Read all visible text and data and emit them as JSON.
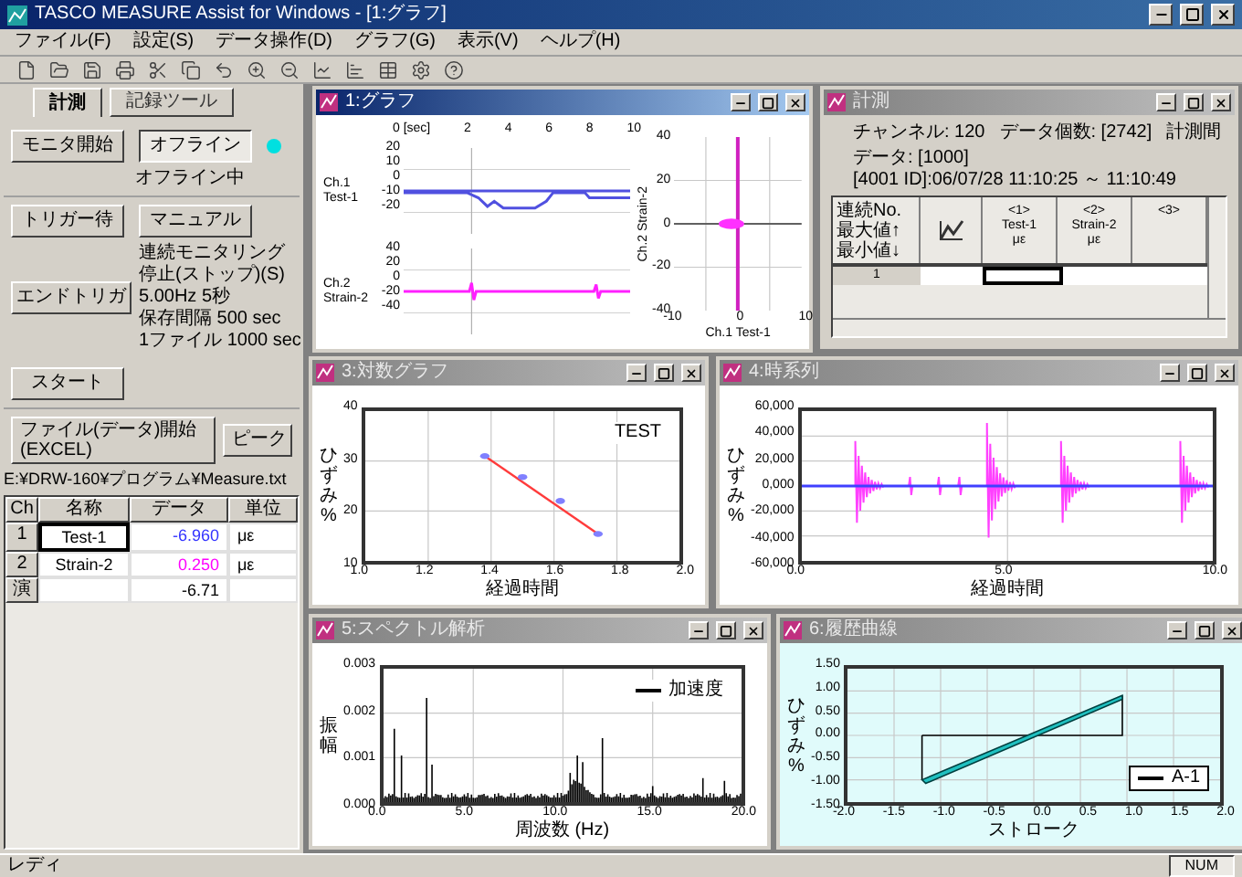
{
  "window": {
    "title": "TASCO MEASURE Assist for Windows - [1:グラフ]"
  },
  "menu": [
    "ファイル(F)",
    "設定(S)",
    "データ操作(D)",
    "グラフ(G)",
    "表示(V)",
    "ヘルプ(H)"
  ],
  "left_panel": {
    "tabs": [
      {
        "label": "計測",
        "selected": true
      },
      {
        "label": "記録ツール",
        "selected": false
      }
    ],
    "mode_buttons": [
      {
        "label": "モニタ開始",
        "pressed": false
      },
      {
        "label": "オフライン",
        "pressed": true
      }
    ],
    "lamp": {
      "on": true
    },
    "mode_status": "オフライン中",
    "trigger_buttons": [
      "トリガー待",
      "マニュアル"
    ],
    "end_button": "エンドトリガ",
    "settings_lines": [
      "連続モニタリング",
      "停止(ストップ)(S)",
      "5.00Hz 5秒",
      "保存間隔 500 sec",
      "1ファイル 1000 sec"
    ],
    "start_button": "スタート",
    "file_button": "ファイル(データ)開始(EXCEL)",
    "peak_button": "ピーク",
    "path": "E:¥DRW-160¥プログラム¥Measure.txt",
    "table": {
      "columns": [
        "Ch",
        "名称",
        "データ",
        "単位"
      ],
      "rows": [
        {
          "ch": "1",
          "name": "Test-1",
          "value": "-6.960",
          "unit": "με",
          "color": "#3333ff",
          "selected": true
        },
        {
          "ch": "2",
          "name": "Strain-2",
          "value": "0.250",
          "unit": "με",
          "color": "#ff00ff",
          "selected": false
        },
        {
          "ch": "演",
          "value": "-6.71",
          "color": "#000000",
          "selected": false
        }
      ]
    }
  },
  "windows": [
    {
      "kind": "time",
      "title": "1:グラフ",
      "active": true,
      "xticks": [
        "0 [sec]",
        "2",
        "4",
        "6",
        "8",
        "10"
      ],
      "channels": [
        {
          "label": "Ch.1",
          "name": "Test-1",
          "yticks": [
            "20",
            "10",
            "0",
            "-10",
            "-20"
          ]
        },
        {
          "label": "Ch.2",
          "name": "Strain-2",
          "yticks": [
            "40",
            "20",
            "0",
            "-20",
            "-40"
          ]
        }
      ],
      "xy": {
        "yticks": [
          "40",
          "20",
          "0",
          "-20",
          "-40"
        ],
        "xticks": [
          "-10",
          "0",
          "10"
        ],
        "xlabel": "Ch.1 Test-1",
        "ylabel": "Ch.2 Strain-2"
      }
    },
    {
      "kind": "table",
      "title": "計測",
      "active": false,
      "lines": [
        [
          "チャンネル: 120",
          "データ個数: [2742]",
          "計測間"
        ],
        [
          "データ: [1000]",
          "[4001 ID]:06/07/28 11:10:25 ～ 11:10:49"
        ]
      ],
      "header": [
        "連続No.",
        "最大値↑",
        "最小値↓"
      ],
      "columns": [
        [
          "<1>",
          "Test-1",
          "με"
        ],
        [
          "<2>",
          "Strain-2",
          "με"
        ],
        [
          "<3>"
        ]
      ],
      "row_label": "1"
    },
    {
      "kind": "log-line",
      "title": "3:対数グラフ",
      "active": false,
      "yticks": [
        "40",
        "30",
        "20",
        "10"
      ],
      "xticks": [
        "1.0",
        "1.2",
        "1.4",
        "1.6",
        "1.8",
        "2.0"
      ],
      "xlabel": "経過時間",
      "ylabel": "ひずみ%",
      "legend": "TEST"
    },
    {
      "kind": "bursts",
      "title": "4:時系列",
      "active": false,
      "yticks": [
        "60,000",
        "40,000",
        "20,000",
        "0,000",
        "-20,000",
        "-40,000",
        "-60,000"
      ],
      "xticks": [
        "0.0",
        "5.0",
        "10.0"
      ],
      "xlabel": "経過時間",
      "ylabel": "ひずみ%"
    },
    {
      "kind": "spectrum",
      "title": "5:スペクトル解析",
      "active": false,
      "yticks": [
        "0.003",
        "0.002",
        "0.001",
        "0.000"
      ],
      "xticks": [
        "0.0",
        "5.0",
        "10.0",
        "15.0",
        "20.0"
      ],
      "xlabel": "周波数 (Hz)",
      "ylabel": "振幅",
      "legend": "加速度"
    },
    {
      "kind": "loop",
      "title": "6:履歴曲線",
      "active": false,
      "yticks": [
        "1.50",
        "1.00",
        "0.50",
        "0.00",
        "-0.50",
        "-1.00",
        "-1.50"
      ],
      "xticks": [
        "-2.0",
        "-1.5",
        "-1.0",
        "-0.5",
        "0.0",
        "0.5",
        "1.0",
        "1.5",
        "2.0"
      ],
      "xlabel": "ストローク",
      "ylabel": "ひずみ%",
      "legend": "A-1"
    }
  ],
  "status_bar": {
    "text": "レディ",
    "indicator": "NUM"
  }
}
